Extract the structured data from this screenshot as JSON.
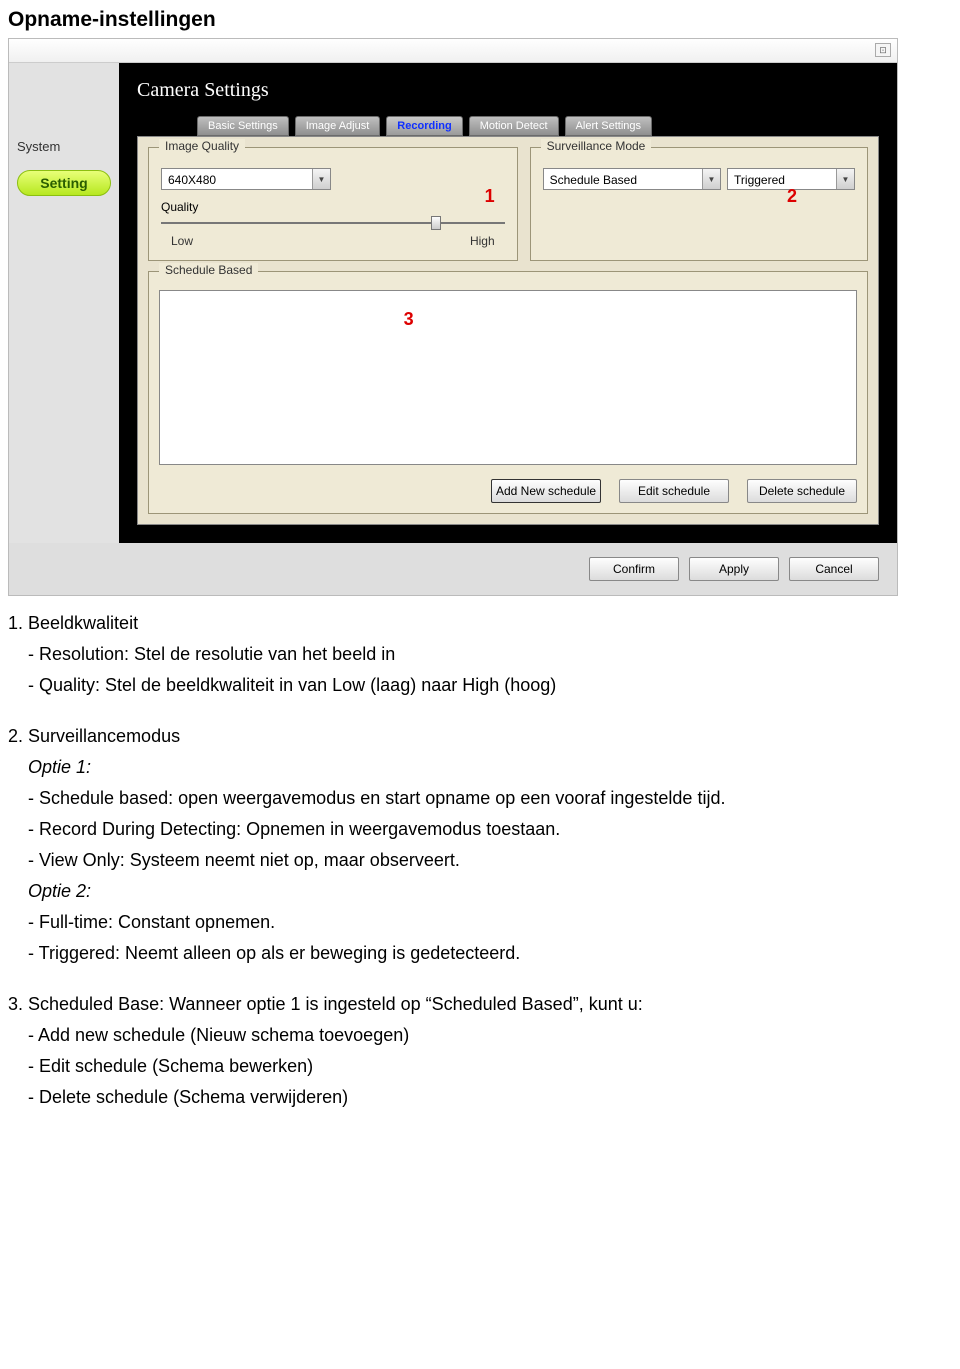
{
  "pageTitle": "Opname-instellingen",
  "window": {
    "closeGlyph": "⊡",
    "sidebar": {
      "system": "System",
      "setting": "Setting"
    },
    "mainTitle": "Camera Settings",
    "tabs": {
      "basic": "Basic Settings",
      "image": "Image Adjust",
      "recording": "Recording",
      "motion": "Motion Detect",
      "alert": "Alert Settings"
    },
    "imageQuality": {
      "groupTitle": "Image Quality",
      "resolution": "640X480",
      "qualityLabel": "Quality",
      "low": "Low",
      "high": "High",
      "marker": "1"
    },
    "surveillance": {
      "groupTitle": "Surveillance Mode",
      "mode": "Schedule Based",
      "trigger": "Triggered",
      "marker": "2"
    },
    "schedule": {
      "groupTitle": "Schedule Based",
      "marker": "3",
      "add": "Add New schedule",
      "edit": "Edit schedule",
      "del": "Delete schedule"
    },
    "footer": {
      "confirm": "Confirm",
      "apply": "Apply",
      "cancel": "Cancel"
    }
  },
  "doc": {
    "s1": {
      "h": "1. Beeldkwaliteit",
      "a": "- Resolution: Stel de resolutie van het beeld in",
      "b": "- Quality: Stel de beeldkwaliteit in van Low (laag) naar High (hoog)"
    },
    "s2": {
      "h": "2. Surveillancemodus",
      "o1": "Optie 1:",
      "o1a": "-   Schedule based: open weergavemodus en start opname op een vooraf ingestelde tijd.",
      "o1b": "-   Record During Detecting: Opnemen in weergavemodus toestaan.",
      "o1c": "-   View Only: Systeem neemt niet op, maar observeert.",
      "o2": "Optie 2:",
      "o2a": "-   Full-time: Constant opnemen.",
      "o2b": "-   Triggered: Neemt alleen op als er beweging is gedetecteerd."
    },
    "s3": {
      "h": "3. Scheduled Base: Wanneer optie 1 is ingesteld op “Scheduled Based”, kunt u:",
      "a": "- Add new schedule (Nieuw schema toevoegen)",
      "b": "- Edit schedule (Schema bewerken)",
      "c": "- Delete schedule (Schema verwijderen)"
    }
  }
}
